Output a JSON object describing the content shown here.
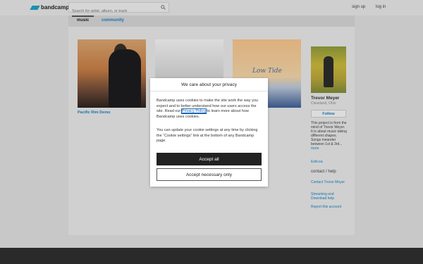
{
  "header": {
    "logo_text": "bandcamp",
    "search_placeholder": "Search for artist, album, or track",
    "signup": "sign up",
    "login": "log in"
  },
  "tabs": {
    "music": "music",
    "community": "community"
  },
  "albums": [
    {
      "title": "Pacific Rim Demo"
    },
    {
      "title": ""
    },
    {
      "title": "",
      "art_text": "Low Tide"
    }
  ],
  "artist": {
    "name": "Trevor Meyer",
    "location": "Cleveland, Ohio",
    "follow": "Follow",
    "bio": "This project is from the mind of Trevor Meyer. It is about music taking different shapes. Songs meander between 1st & 3rd...",
    "bio_more": "more",
    "links": [
      "Enlit.ea"
    ],
    "contact_heading": "contact / help",
    "contact_links": [
      "Contact Trevor Meyer",
      "Streaming and Download help",
      "Report this account"
    ]
  },
  "cookie": {
    "title": "We care about your privacy",
    "p1_before": "Bandcamp uses cookies to make the site work the way you expect and to better understand how our users access the site. Read our ",
    "p1_link": "Privacy Policy",
    "p1_after": " to learn more about how Bandcamp uses cookies.",
    "p2": "You can update your cookie settings at any time by clicking the “Cookie settings” link at the bottom of any Bandcamp page.",
    "accept_all": "Accept all",
    "accept_necessary": "Accept necessary only"
  },
  "colors": {
    "link": "#1a7fc1",
    "logo": "#1da0c3",
    "footer": "#2f2f2f"
  }
}
